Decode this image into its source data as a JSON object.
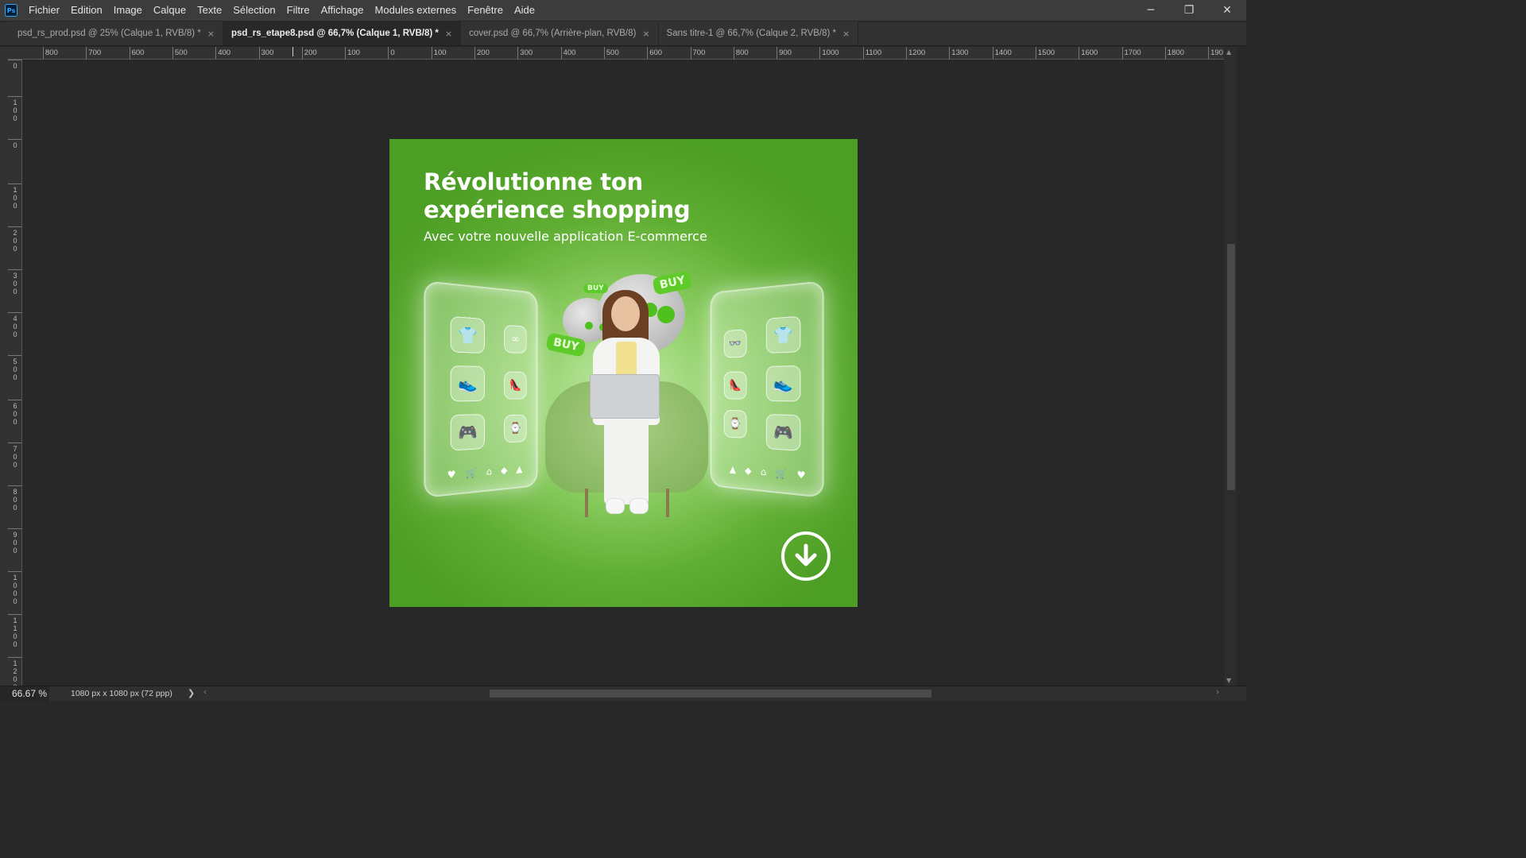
{
  "app": {
    "logo_text": "Ps"
  },
  "menu": {
    "items": [
      "Fichier",
      "Edition",
      "Image",
      "Calque",
      "Texte",
      "Sélection",
      "Filtre",
      "Affichage",
      "Modules externes",
      "Fenêtre",
      "Aide"
    ]
  },
  "window_controls": {
    "minimize": "─",
    "restore": "❐",
    "close": "✕"
  },
  "tabs": [
    {
      "label": "psd_rs_prod.psd @ 25% (Calque 1, RVB/8) *",
      "active": false
    },
    {
      "label": "psd_rs_etape8.psd @ 66,7% (Calque 1, RVB/8) *",
      "active": true
    },
    {
      "label": "cover.psd @ 66,7% (Arrière-plan, RVB/8)",
      "active": false
    },
    {
      "label": "Sans titre-1 @ 66,7% (Calque 2, RVB/8) *",
      "active": false
    }
  ],
  "tab_close_glyph": "×",
  "ruler_top": {
    "labels": [
      "800",
      "700",
      "600",
      "500",
      "400",
      "300",
      "200",
      "100",
      "0",
      "100",
      "200",
      "300",
      "400",
      "500",
      "600",
      "700",
      "800",
      "900",
      "1000",
      "1100",
      "1200",
      "1300",
      "1400",
      "1500",
      "1600",
      "1700",
      "1800",
      "190"
    ]
  },
  "ruler_left": {
    "labels": [
      "0",
      "100",
      "0",
      "100",
      "200",
      "300",
      "400",
      "500",
      "600",
      "700",
      "800",
      "900",
      "1000",
      "1100",
      "1200"
    ]
  },
  "artwork": {
    "title_line1": "Révolutionne ton",
    "title_line2": "expérience shopping",
    "subtitle": "Avec votre nouvelle application E-commerce",
    "buy_tag_1": "BUY",
    "buy_tag_2": "BUY",
    "buy_tag_3": "BUY",
    "left_panel_icons": [
      "shirt-icon",
      "glasses-icon",
      "sneaker-icon",
      "heel-icon",
      "gamepad-icon",
      "watch-icon"
    ],
    "right_panel_icons": [
      "sunglasses-icon",
      "tshirt-icon",
      "heel-icon",
      "sneaker-icon",
      "watch-icon",
      "controller-icon"
    ],
    "panel_bar_icons": [
      "heart-icon",
      "cart-icon",
      "home-icon",
      "tag-icon",
      "bell-icon"
    ],
    "colors": {
      "background": "#5fae32",
      "accent": "#4fc01e",
      "text": "#ffffff"
    }
  },
  "status": {
    "zoom": "66.67 %",
    "document_info": "1080 px x 1080 px (72 ppp)",
    "arrow": "❯"
  },
  "colors": {
    "workspace": "#282828",
    "chrome": "#3c3c3c",
    "active_tab": "#282828"
  }
}
